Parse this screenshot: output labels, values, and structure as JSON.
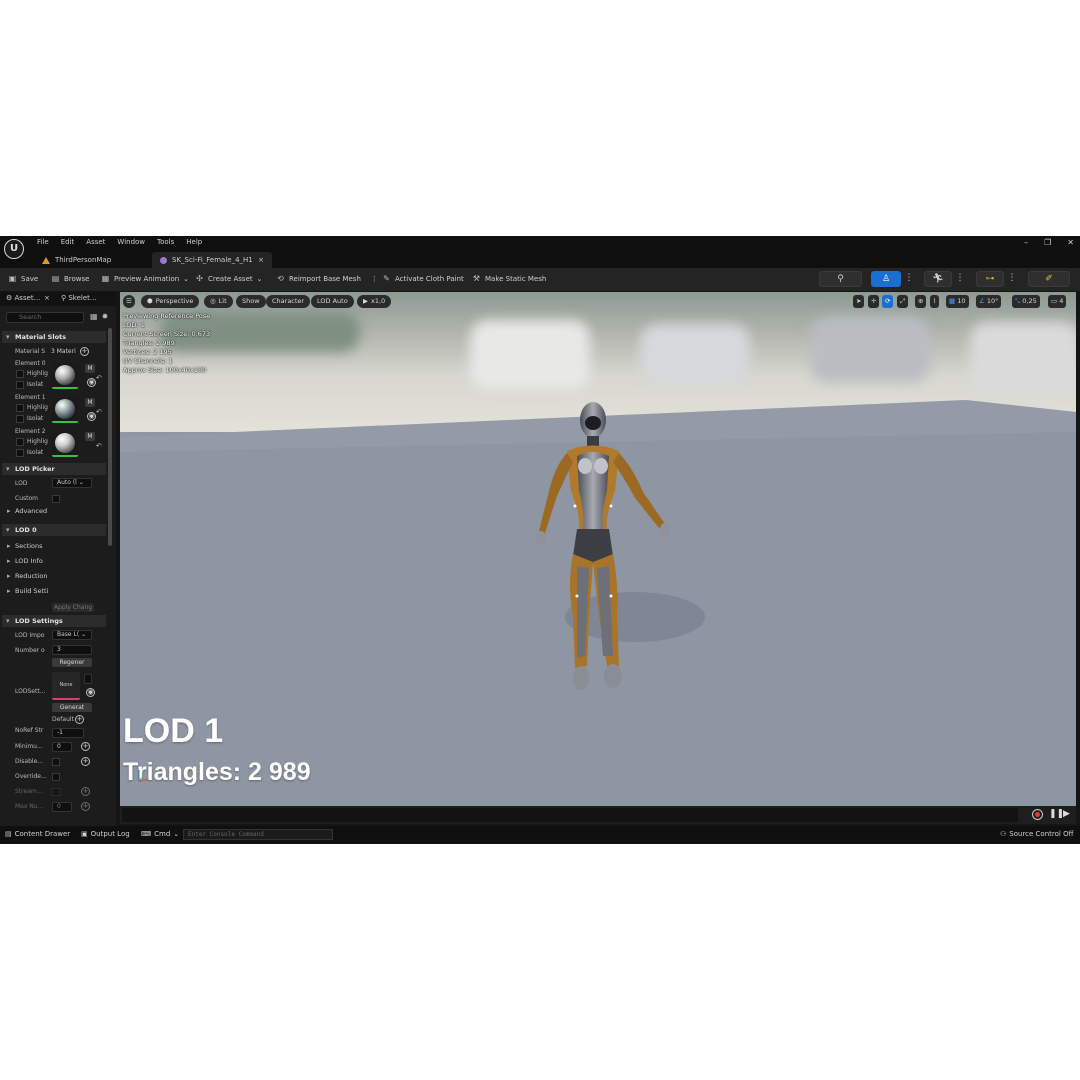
{
  "menu": [
    "File",
    "Edit",
    "Asset",
    "Window",
    "Tools",
    "Help"
  ],
  "window_controls": {
    "minimize": "–",
    "restore": "❐",
    "close": "✕"
  },
  "tabs": [
    {
      "label": "ThirdPersonMap",
      "icon": "level-map-icon"
    },
    {
      "label": "SK_Sci-Fi_Female_4_H1",
      "icon": "skeletal-mesh-icon",
      "close": "×"
    }
  ],
  "toolbar": {
    "save": "Save",
    "browse": "Browse",
    "preview_animation": "Preview Animation",
    "create_asset": "Create Asset",
    "reimport": "Reimport Base Mesh",
    "activate_cloth": "Activate Cloth Paint",
    "make_static": "Make Static Mesh"
  },
  "left_panel": {
    "tab1": "Asset...",
    "tab1_close": "×",
    "tab2": "Skelet...",
    "search_placeholder": "Search",
    "material_slots": {
      "header": "Material Slots",
      "label": "Material S",
      "count": "3 Materi",
      "elements": [
        {
          "label": "Element 0",
          "highlight": "Highlig",
          "isolate": "Isolat",
          "btn": "M"
        },
        {
          "label": "Element 1",
          "highlight": "Highlig",
          "isolate": "Isolat",
          "btn": "M"
        },
        {
          "label": "Element 2",
          "highlight": "Highlig",
          "isolate": "Isolat",
          "btn": "M"
        }
      ]
    },
    "lod_picker": {
      "header": "LOD Picker",
      "lod_label": "LOD",
      "lod_value": "Auto (l",
      "custom_label": "Custom",
      "advanced": "Advanced"
    },
    "lod0": {
      "header": "LOD 0",
      "items": [
        "Sections",
        "LOD Info",
        "Reduction",
        "Build Setti"
      ],
      "apply": "Apply Chang"
    },
    "lod_settings": {
      "header": "LOD Settings",
      "import_label": "LOD Impo",
      "import_value": "Base L(",
      "number_label": "Number o",
      "number_value": "3",
      "regen": "Regener",
      "lodsett_label": "LODSett...",
      "lodsett_value": "None",
      "generate": "Generat",
      "default_label": "Default",
      "noref_label": "NoRef Str",
      "noref_value": "-1",
      "minimum_label": "Minimu...",
      "minimum_value": "0",
      "disable_label": "Disable...",
      "override_label": "Override...",
      "stream_label": "Stream...",
      "maxnu_label": "Max Nu...",
      "maxnu_value": "0"
    }
  },
  "viewport": {
    "buttons": {
      "menu": "☰",
      "perspective": "Perspective",
      "lit": "Lit",
      "show": "Show",
      "character": "Character",
      "lod": "LOD Auto",
      "speed": "x1,0"
    },
    "right_controls": {
      "grid": "10",
      "angle": "10°",
      "scale": "0,25",
      "camera": "4"
    },
    "info_lines": [
      "Previewing Reference Pose",
      "LOD: 1",
      "Current Screen Size: 0,673",
      "Triangles: 2 989",
      "Vertices: 2 195",
      "UV Channels: 1",
      "Approx Size: 100x40x180"
    ],
    "big_lod": "LOD 1",
    "big_triangles": "Triangles: 2 989"
  },
  "statusbar": {
    "content_drawer": "Content Drawer",
    "output_log": "Output Log",
    "cmd": "Cmd",
    "console_placeholder": "Enter Console Command",
    "source_control": "Source Control Off"
  },
  "colors": {
    "accent": "#1a6fd1",
    "floor": "#8f96a4",
    "panel": "#1c1c1c"
  }
}
